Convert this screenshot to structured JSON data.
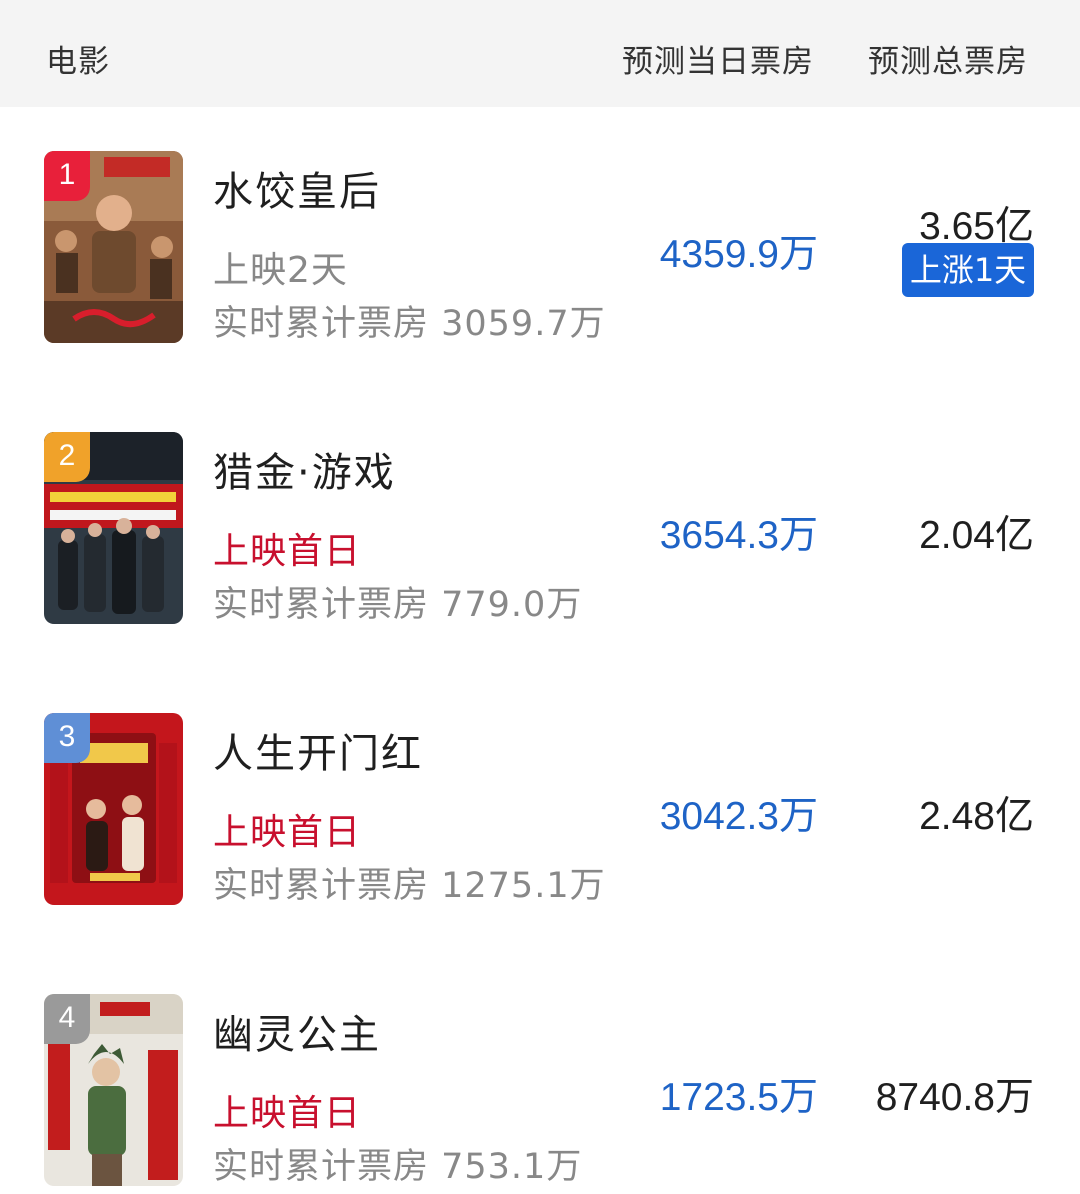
{
  "header": {
    "movie": "电影",
    "daily": "预测当日票房",
    "total": "预测总票房"
  },
  "movies": [
    {
      "rank": "1",
      "title": "水饺皇后",
      "status": "上映2天",
      "cumulative": "实时累计票房 3059.7万",
      "daily": "4359.9万",
      "total": "3.65亿",
      "badge": "上涨1天",
      "rank_color": "#e8203a"
    },
    {
      "rank": "2",
      "title": "猎金·游戏",
      "status": "上映首日",
      "cumulative": "实时累计票房 779.0万",
      "daily": "3654.3万",
      "total": "2.04亿",
      "rank_color": "#f0a22a"
    },
    {
      "rank": "3",
      "title": "人生开门红",
      "status": "上映首日",
      "cumulative": "实时累计票房 1275.1万",
      "daily": "3042.3万",
      "total": "2.48亿",
      "rank_color": "#5f8fd6"
    },
    {
      "rank": "4",
      "title": "幽灵公主",
      "status": "上映首日",
      "cumulative": "实时累计票房 753.1万",
      "daily": "1723.5万",
      "total": "8740.8万",
      "rank_color": "#9a9a9a"
    }
  ]
}
